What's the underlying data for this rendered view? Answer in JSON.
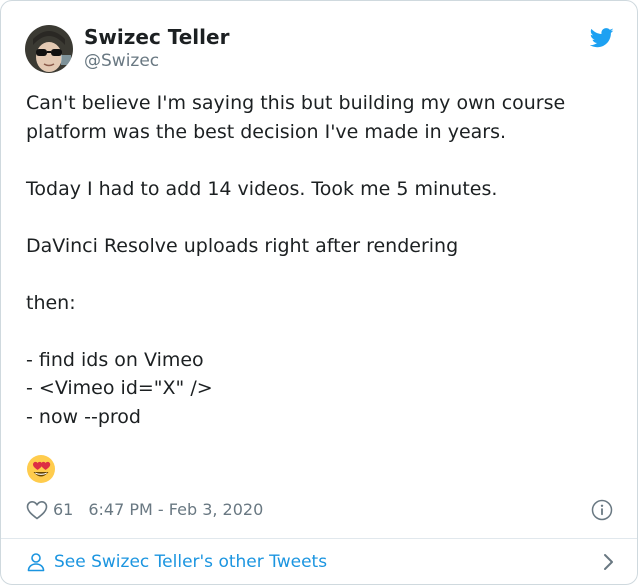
{
  "author": {
    "name": "Swizec Teller",
    "handle": "@Swizec"
  },
  "tweet": {
    "text": "Can't believe I'm saying this but building my own course platform was the best decision I've made in years.\n\nToday I had to add 14 videos. Took me 5 minutes.\n\nDaVinci Resolve uploads right after rendering\n\nthen:\n\n- find ids on Vimeo\n- <Vimeo id=\"X\" />\n- now --prod",
    "emoji": "smiling-face-with-heart-eyes"
  },
  "meta": {
    "like_count": "61",
    "timestamp": "6:47 PM - Feb 3, 2020"
  },
  "footer": {
    "link_text": "See Swizec Teller's other Tweets"
  },
  "colors": {
    "accent": "#1b95e0",
    "twitter_blue": "#1da1f2",
    "muted": "#697882"
  },
  "icons": [
    "twitter-bird-icon",
    "heart-icon",
    "info-icon",
    "person-icon",
    "chevron-right-icon"
  ]
}
